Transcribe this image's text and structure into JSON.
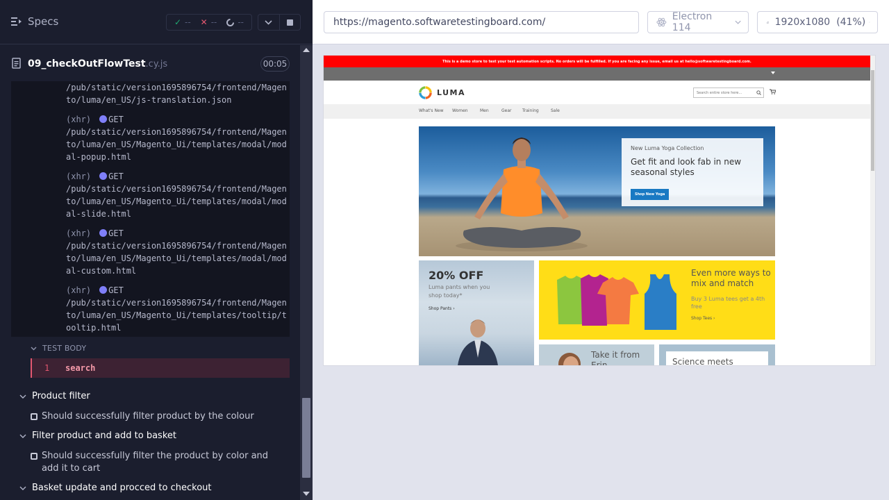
{
  "reporter": {
    "specs_label": "Specs",
    "stats": {
      "passed": "--",
      "failed": "--",
      "pending": "--"
    },
    "spec_file": {
      "name": "09_checkOutFlowTest",
      "ext": ".cy.js",
      "duration": "00:05"
    },
    "log_entries": [
      {
        "tag": "",
        "method": "",
        "url": "/pub/static/version1695896754/frontend/Magento/luma/en_US/js-translation.json"
      },
      {
        "tag": "(xhr)",
        "method": "GET",
        "url": "/pub/static/version1695896754/frontend/Magento/luma/en_US/Magento_Ui/templates/modal/modal-popup.html"
      },
      {
        "tag": "(xhr)",
        "method": "GET",
        "url": "/pub/static/version1695896754/frontend/Magento/luma/en_US/Magento_Ui/templates/modal/modal-slide.html"
      },
      {
        "tag": "(xhr)",
        "method": "GET",
        "url": "/pub/static/version1695896754/frontend/Magento/luma/en_US/Magento_Ui/templates/modal/modal-custom.html"
      },
      {
        "tag": "(xhr)",
        "method": "GET",
        "url": "/pub/static/version1695896754/frontend/Magento/luma/en_US/Magento_Ui/templates/tooltip/tooltip.html"
      }
    ],
    "test_body_label": "TEST BODY",
    "command": {
      "number": "1",
      "name": "search"
    },
    "suites": [
      {
        "title": "Product filter",
        "tests": [
          "Should successfully filter product by the colour"
        ]
      },
      {
        "title": "Filter product and add to basket",
        "tests": [
          "Should successfully filter the product by color and add it to cart"
        ]
      },
      {
        "title": "Basket update and procced to checkout",
        "tests": []
      }
    ]
  },
  "aut": {
    "url": "https://magento.softwaretestingboard.com/",
    "browser": "Electron 114",
    "viewport": "1920x1080",
    "scale": "(41%)"
  },
  "site": {
    "demo_notice": "This is a demo store to test your test automation scripts. No orders will be fulfilled. If you are facing any issue, email us at hello@softwaretestingboard.com.",
    "logo": "LUMA",
    "search_placeholder": "Search entire store here...",
    "nav": [
      "What's New",
      "Women",
      "Men",
      "Gear",
      "Training",
      "Sale"
    ],
    "hero": {
      "kicker": "New Luma Yoga Collection",
      "title": "Get fit and look fab in new seasonal styles",
      "button": "Shop New Yoga"
    },
    "promo_pants": {
      "headline": "20% OFF",
      "text": "Luma pants when you shop today*",
      "link": "Shop Pants ›"
    },
    "promo_tees": {
      "headline": "Even more ways to mix and match",
      "text": "Buy 3 Luma tees get a 4th free",
      "link": "Shop Tees ›"
    },
    "promo_erin": {
      "headline": "Take it from Erin"
    },
    "promo_science": {
      "headline": "Science meets"
    }
  },
  "colors": {
    "reporter_bg": "#1b1e2e",
    "log_bg": "#131520",
    "passed": "#1fa971",
    "failed": "#e45770",
    "xhr_dot": "#7f7ff9",
    "command_highlight": "#3d2233",
    "demo_bar": "#ff0000",
    "luma_button": "#1979c3",
    "tees_bg": "#ffdd17"
  }
}
